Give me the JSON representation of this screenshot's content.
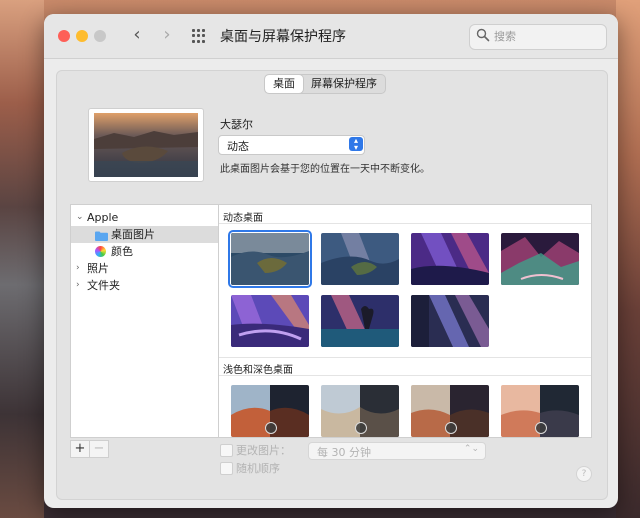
{
  "window": {
    "title": "桌面与屏幕保护程序",
    "back_icon": "chevron-left-icon",
    "forward_icon": "chevron-right-icon",
    "grid_icon": "show-all-grid-icon"
  },
  "search": {
    "placeholder": "搜索",
    "value": ""
  },
  "tabs": [
    {
      "label": "桌面",
      "active": true
    },
    {
      "label": "屏幕保护程序",
      "active": false
    }
  ],
  "current": {
    "name": "大瑟尔",
    "mode_value": "动态",
    "description": "此桌面图片会基于您的位置在一天中不断变化。"
  },
  "sidebar": {
    "items": [
      {
        "label": "Apple",
        "arrow": "⌄",
        "level": 0
      },
      {
        "label": "桌面图片",
        "icon": "folder-icon",
        "level": 1,
        "selected": true
      },
      {
        "label": "颜色",
        "icon": "color-wheel-icon",
        "level": 1
      },
      {
        "label": "照片",
        "arrow": "›",
        "level": 0
      },
      {
        "label": "文件夹",
        "arrow": "›",
        "level": 0
      }
    ]
  },
  "sections": {
    "dynamic": {
      "title": "动态桌面"
    },
    "light_dark": {
      "title": "浅色和深色桌面"
    }
  },
  "controls": {
    "add_label": "+",
    "remove_label": "−",
    "change_picture_label": "更改图片：",
    "change_picture_checked": false,
    "interval_value": "每 30 分钟",
    "random_order_label": "随机顺序",
    "random_order_checked": false,
    "help_label": "?"
  },
  "colors": {
    "accent": "#2f78e8",
    "close": "#fe5f57",
    "minimize": "#febc2e"
  }
}
